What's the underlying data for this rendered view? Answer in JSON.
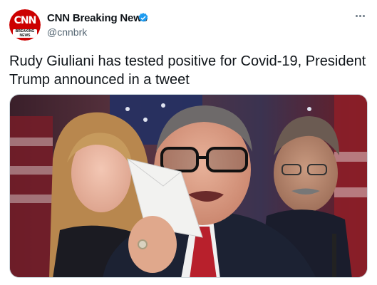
{
  "account": {
    "name": "CNN Breaking News",
    "handle": "@cnnbrk",
    "logo_text": "CNN",
    "logo_subtext": "BREAKING NEWS"
  },
  "tweet": {
    "text": "Rudy Giuliani has tested positive for Covid-19, President Trump announced in a tweet"
  },
  "colors": {
    "brand_red": "#cc0000",
    "verified_blue": "#1d9bf0"
  },
  "icons": {
    "verified": "verified-badge-icon",
    "more": "more-options-icon"
  }
}
